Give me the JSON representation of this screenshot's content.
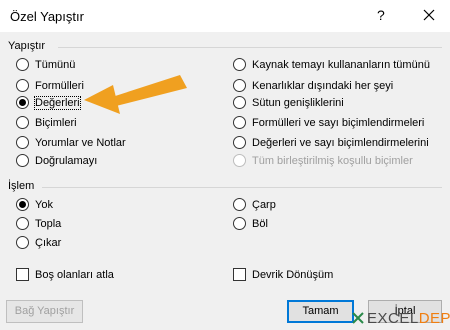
{
  "dialog": {
    "title": "Özel Yapıştır",
    "help_label": "?"
  },
  "paste_group": {
    "label": "Yapıştır",
    "left_options": [
      {
        "label": "Tümünü",
        "selected": false
      },
      {
        "label": "Formülleri",
        "selected": false
      },
      {
        "label": "Değerleri",
        "selected": true
      },
      {
        "label": "Biçimleri",
        "selected": false
      },
      {
        "label": "Yorumlar ve Notlar",
        "selected": false
      },
      {
        "label": "Doğrulamayı",
        "selected": false
      }
    ],
    "right_options": [
      {
        "label": "Kaynak temayı kullananların tümünü",
        "selected": false
      },
      {
        "label": "Kenarlıklar dışındaki her şeyi",
        "selected": false
      },
      {
        "label": "Sütun genişliklerini",
        "selected": false
      },
      {
        "label": "Formülleri ve sayı biçimlendirmeleri",
        "selected": false
      },
      {
        "label": "Değerleri ve sayı biçimlendirmelerini",
        "selected": false
      },
      {
        "label": "Tüm birleştirilmiş koşullu biçimler",
        "selected": false,
        "disabled": true
      }
    ]
  },
  "operation_group": {
    "label": "İşlem",
    "left_options": [
      {
        "label": "Yok",
        "selected": true
      },
      {
        "label": "Topla",
        "selected": false
      },
      {
        "label": "Çıkar",
        "selected": false
      }
    ],
    "right_options": [
      {
        "label": "Çarp",
        "selected": false
      },
      {
        "label": "Böl",
        "selected": false
      }
    ]
  },
  "checkboxes": {
    "skip_blanks": {
      "label": "Boş olanları atla",
      "checked": false
    },
    "transpose": {
      "label": "Devrik Dönüşüm",
      "checked": false
    }
  },
  "buttons": {
    "paste_link": "Bağ Yapıştır",
    "ok": "Tamam",
    "cancel": "İptal"
  },
  "watermark": {
    "prefix": "EXCEL",
    "suffix": "DEPO"
  },
  "colors": {
    "accent_border": "#0078d7",
    "arrow": "#f0a020",
    "watermark_accent": "#f07e10"
  }
}
